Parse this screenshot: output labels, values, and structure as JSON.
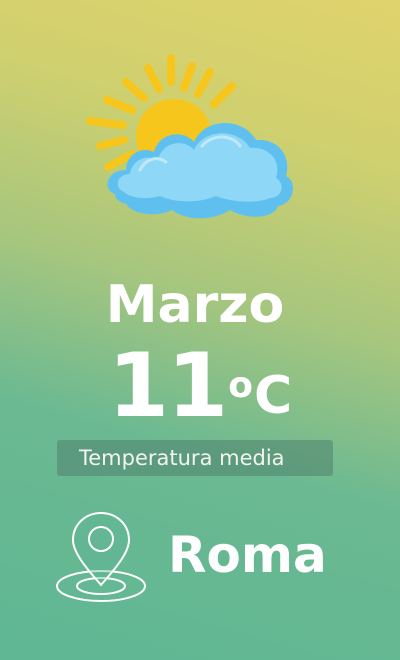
{
  "icons": {
    "weather": "sun-behind-cloud-icon",
    "location": "map-pin-icon"
  },
  "colors": {
    "sun": "#f7c61c",
    "cloud": "#6ec6f2",
    "text": "#ffffff"
  },
  "month": "Marzo",
  "temperature": {
    "value": "11",
    "degree": "o",
    "unit": "C",
    "label": "Temperatura media"
  },
  "location": {
    "city": "Roma"
  }
}
